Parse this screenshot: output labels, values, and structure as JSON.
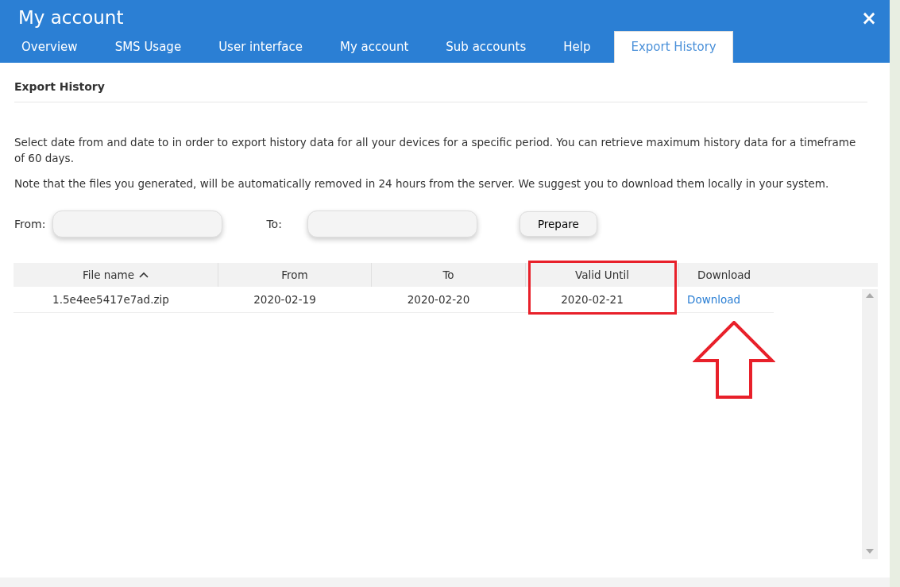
{
  "window": {
    "title": "My account",
    "close": "×"
  },
  "tabs": [
    {
      "label": "Overview",
      "selected": false
    },
    {
      "label": "SMS Usage",
      "selected": false
    },
    {
      "label": "User interface",
      "selected": false
    },
    {
      "label": "My account",
      "selected": false
    },
    {
      "label": "Sub accounts",
      "selected": false
    },
    {
      "label": "Help",
      "selected": false
    },
    {
      "label": "Export History",
      "selected": true
    }
  ],
  "section_title": "Export History",
  "paragraphs": [
    "Select date from and date to in order to export history data for all your devices for a specific period. You can retrieve maximum history data for a timeframe of 60 days.",
    "Note that the files you generated, will be automatically removed in 24 hours from the server. We suggest you to download them locally in your system."
  ],
  "form": {
    "from_label": "From:",
    "to_label": "To:",
    "button": "Prepare"
  },
  "table": {
    "columns": [
      {
        "label": "File name",
        "sorted": true
      },
      {
        "label": "From",
        "sorted": false
      },
      {
        "label": "To",
        "sorted": false
      },
      {
        "label": "Valid Until",
        "sorted": false
      },
      {
        "label": "Download",
        "sorted": false
      }
    ],
    "rows": [
      {
        "file": "1.5e4ee5417e7ad.zip",
        "from": "2020-02-19",
        "to": "2020-02-20",
        "valid_until": "2020-02-21",
        "download": "Download"
      }
    ]
  }
}
